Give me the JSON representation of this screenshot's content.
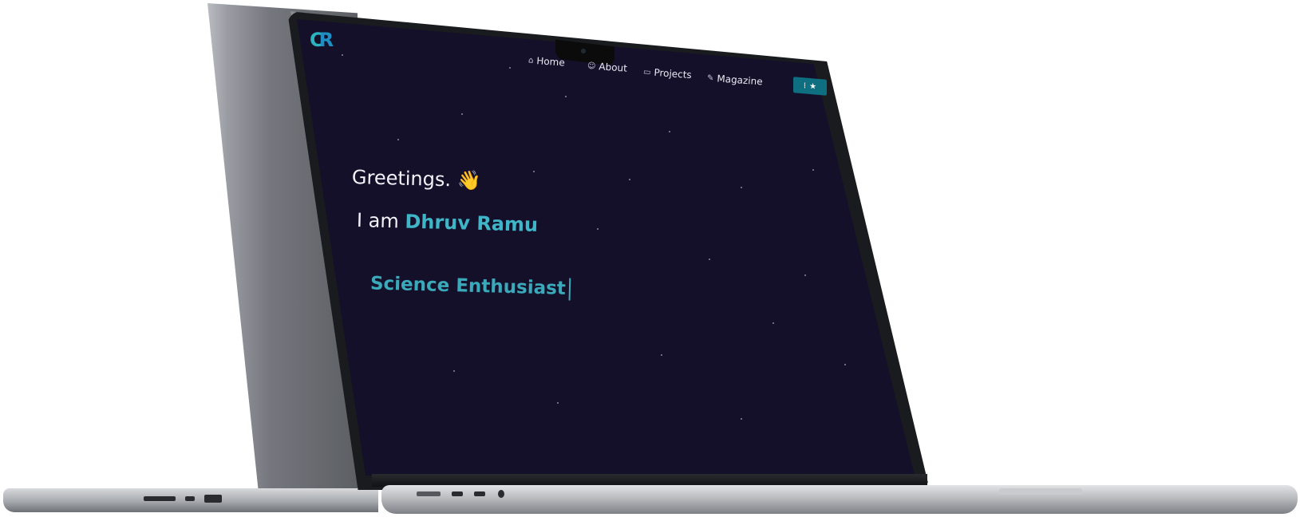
{
  "logo": {
    "c": "C",
    "r": "R"
  },
  "nav": {
    "items": [
      {
        "icon": "⌂",
        "label": "Home"
      },
      {
        "icon": "☺",
        "label": "About"
      },
      {
        "icon": "▭",
        "label": "Projects"
      },
      {
        "icon": "✎",
        "label": "Magazine"
      }
    ],
    "theme_toggle": {
      "icon_a": "⁞",
      "icon_b": "★"
    }
  },
  "hero": {
    "greeting": "Greetings.",
    "wave_emoji": "👋",
    "intro": "I am",
    "name": "Dhruv Ramu",
    "role": "Science Enthusiast"
  },
  "colors": {
    "accent": "#3fb6c7",
    "background": "#15102a",
    "toggle": "#0e6f80"
  }
}
